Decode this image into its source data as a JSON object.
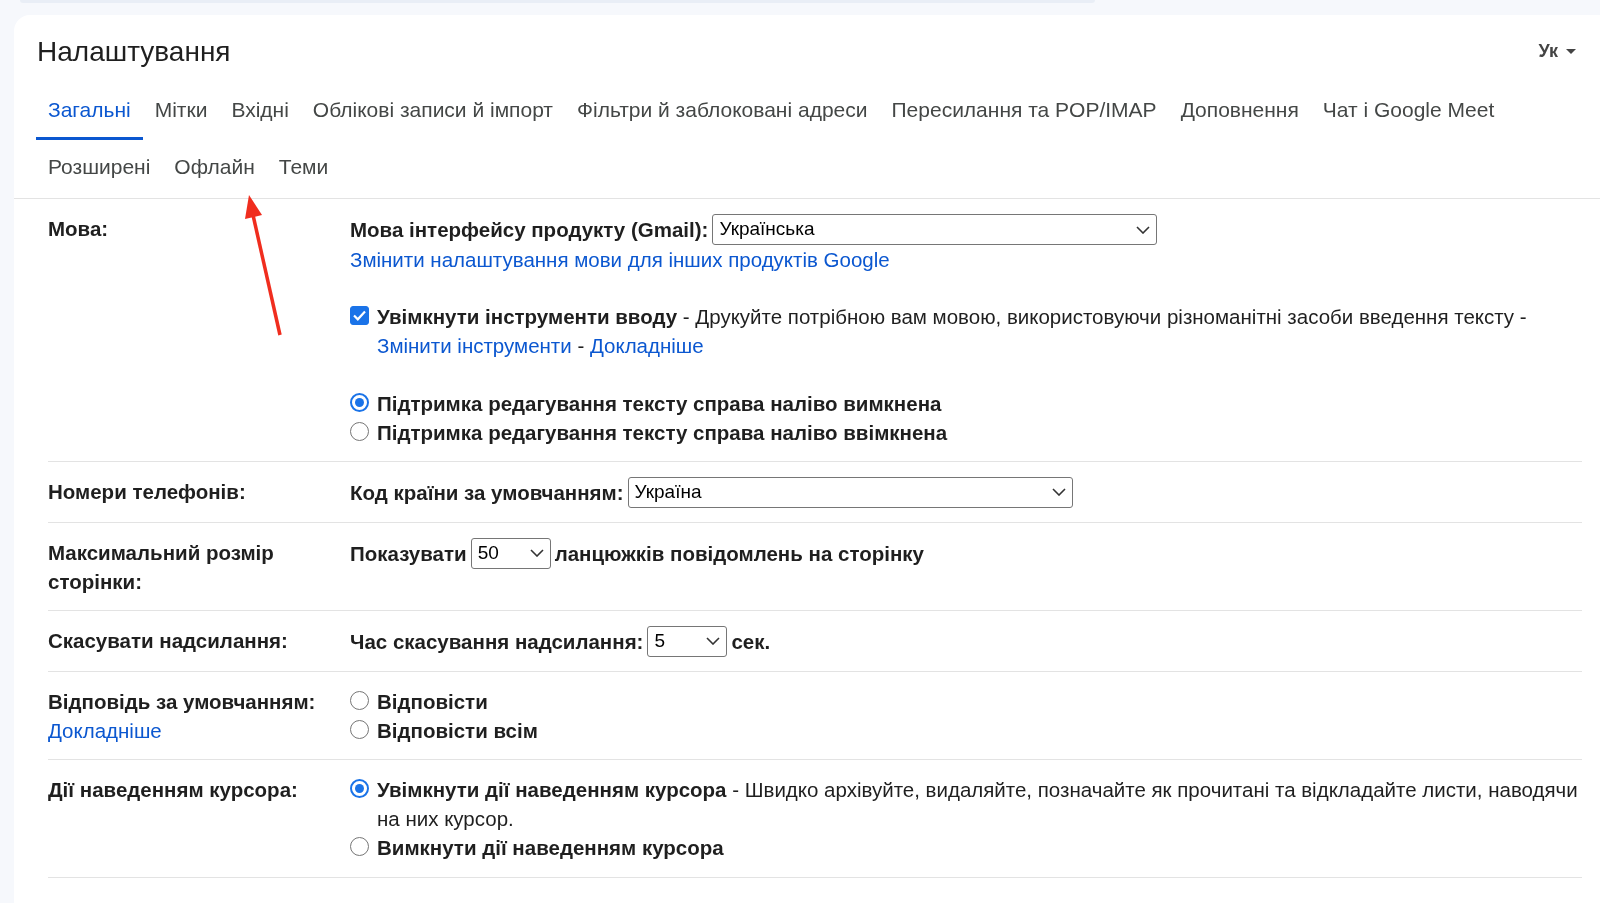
{
  "title": "Налаштування",
  "input_tools": {
    "label": "Ук"
  },
  "tab_rows": [
    {
      "tabs": [
        {
          "label": "Загальні",
          "selected": true
        },
        {
          "label": "Мітки",
          "selected": false
        },
        {
          "label": "Вхідні",
          "selected": false
        },
        {
          "label": "Облікові записи й імпорт",
          "selected": false
        },
        {
          "label": "Фільтри й заблоковані адреси",
          "selected": false
        },
        {
          "label": "Пересилання та POP/IMAP",
          "selected": false
        },
        {
          "label": "Доповнення",
          "selected": false
        },
        {
          "label": "Чат і Google Meet",
          "selected": false
        }
      ]
    },
    {
      "tabs": [
        {
          "label": "Розширені",
          "selected": false
        },
        {
          "label": "Офлайн",
          "selected": false
        },
        {
          "label": "Теми",
          "selected": false
        }
      ]
    }
  ],
  "sections": [
    {
      "label": "Мова:",
      "groups": [
        [
          {
            "kind": "select",
            "before": "Мова інтерфейсу продукту (Gmail):",
            "value": "Українська"
          },
          {
            "kind": "link",
            "text": "Змінити налаштування мови для інших продуктів Google"
          }
        ],
        [
          {
            "kind": "checkbox",
            "checked": true,
            "parts": [
              {
                "text": "**Увімкнути інструменти вводу** - Друкуйте потрібною вам мовою, використовуючи різноманітні засоби введення тексту - ",
                "kind": "text"
              },
              {
                "text": "Змінити інструменти",
                "kind": "link"
              },
              {
                "text": " - ",
                "kind": "text"
              },
              {
                "text": "Докладніше",
                "kind": "link"
              }
            ]
          }
        ],
        [
          {
            "kind": "radio",
            "selected": true,
            "label": "Підтримка редагування тексту справа наліво вимкнена"
          },
          {
            "kind": "radio",
            "selected": false,
            "label": "Підтримка редагування тексту справа наліво ввімкнена"
          }
        ]
      ]
    },
    {
      "label": "Номери телефонів:",
      "groups": [
        [
          {
            "kind": "select",
            "before": "Код країни за умовчанням:",
            "value": "Україна"
          }
        ]
      ]
    },
    {
      "label": "Максимальний розмір сторінки:",
      "groups": [
        [
          {
            "kind": "select",
            "before": "Показувати",
            "value": "50",
            "after": "ланцюжків повідомлень на сторінку"
          }
        ]
      ]
    },
    {
      "label": "Скасувати надсилання:",
      "groups": [
        [
          {
            "kind": "select",
            "before": "Час скасування надсилання:",
            "value": "5",
            "after": "сек."
          }
        ]
      ]
    },
    {
      "label": "Відповідь за умовчанням:",
      "link": "Докладніше",
      "groups": [
        [
          {
            "kind": "radio",
            "selected": false,
            "label": "Відповісти"
          },
          {
            "kind": "radio",
            "selected": false,
            "label": "Відповісти всім"
          }
        ]
      ]
    },
    {
      "label": "Дії наведенням курсора:",
      "groups": [
        [
          {
            "kind": "radio",
            "selected": true,
            "label": "Увімкнути дії наведенням курсора",
            "description": " - Швидко архівуйте, видаляйте, позначайте як прочитані та відкладайте листи, наводячи на них курсор."
          },
          {
            "kind": "radio",
            "selected": false,
            "label": "Вимкнути дії наведенням курсора"
          }
        ]
      ]
    }
  ]
}
